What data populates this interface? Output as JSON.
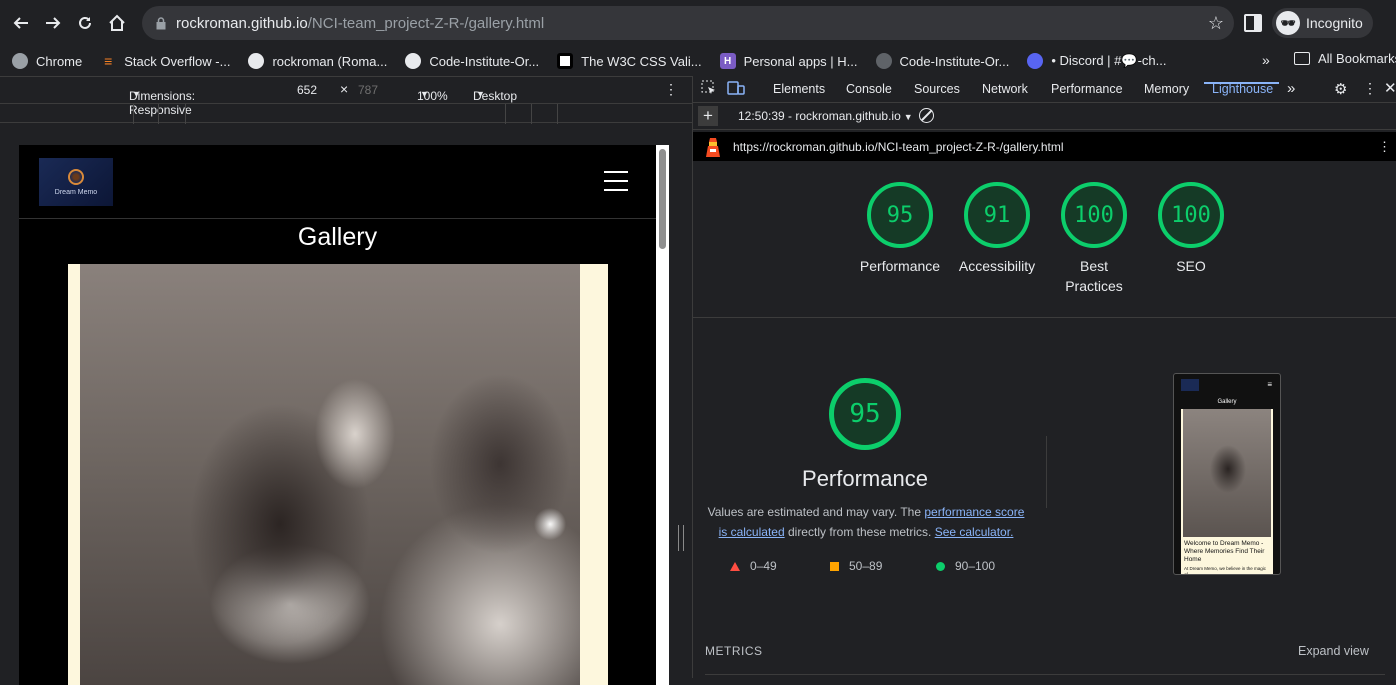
{
  "browser": {
    "url_host": "rockroman.github.io",
    "url_path": "/NCI-team_project-Z-R-/gallery.html",
    "profile_label": "Incognito"
  },
  "bookmarks": {
    "items": [
      {
        "label": "Chrome",
        "icon": "chrome-icon",
        "color": "#9aa0a6"
      },
      {
        "label": "Stack Overflow -...",
        "icon": "stackoverflow-icon",
        "color": "#f48024"
      },
      {
        "label": "rockroman (Roma...",
        "icon": "github-icon",
        "color": "#e8eaed"
      },
      {
        "label": "Code-Institute-Or...",
        "icon": "github-icon",
        "color": "#e8eaed"
      },
      {
        "label": "The W3C CSS Vali...",
        "icon": "w3c-icon",
        "color": "#ffffff"
      },
      {
        "label": "Personal apps | H...",
        "icon": "heroku-icon",
        "color": "#7b5cc4"
      },
      {
        "label": "Code-Institute-Or...",
        "icon": "github-icon",
        "color": "#5f6368"
      },
      {
        "label": "• Discord | #💬-ch...",
        "icon": "discord-icon",
        "color": "#5865f2"
      }
    ],
    "overflow": "»",
    "all_bookmarks": "All Bookmarks"
  },
  "device_toolbar": {
    "dimensions": "Dimensions: Responsive",
    "width": "652",
    "times": "×",
    "height": "787",
    "zoom": "100%",
    "device_type": "Desktop"
  },
  "site": {
    "logo_text": "Dream Memo",
    "page_title": "Gallery"
  },
  "devtools": {
    "tabs": [
      "Elements",
      "Console",
      "Sources",
      "Network",
      "Performance",
      "Memory",
      "Lighthouse"
    ],
    "active_tab": "Lighthouse",
    "more_tabs": "»",
    "report_select": "12:50:39 - rockroman.github.io",
    "report_url": "https://rockroman.github.io/NCI-team_project-Z-R-/gallery.html"
  },
  "lighthouse": {
    "scores": [
      {
        "value": "95",
        "label": "Performance",
        "label2": ""
      },
      {
        "value": "91",
        "label": "Accessibility",
        "label2": ""
      },
      {
        "value": "100",
        "label": "Best",
        "label2": "Practices"
      },
      {
        "value": "100",
        "label": "SEO",
        "label2": ""
      }
    ],
    "performance": {
      "score": "95",
      "title": "Performance",
      "desc_prefix": "Values are estimated and may vary. The ",
      "desc_link1": "performance score is calculated",
      "desc_mid": " directly from these metrics. ",
      "desc_link2": "See calculator."
    },
    "legend": [
      {
        "range": "0–49",
        "shape": "triangle",
        "color": "#ff4e42"
      },
      {
        "range": "50–89",
        "shape": "square",
        "color": "#ffa400"
      },
      {
        "range": "90–100",
        "shape": "circle",
        "color": "#0cce6b"
      }
    ],
    "thumbnail": {
      "title": "Gallery",
      "heading": "Welcome to Dream Memo - Where Memories Find Their Home",
      "body": "At Dream Memo, we believe in the magic of"
    },
    "metrics_label": "METRICS",
    "expand_view": "Expand view"
  },
  "colors": {
    "score_green": "#0cce6b",
    "link_blue": "#8ab4f8",
    "panel_bg": "#202124"
  }
}
